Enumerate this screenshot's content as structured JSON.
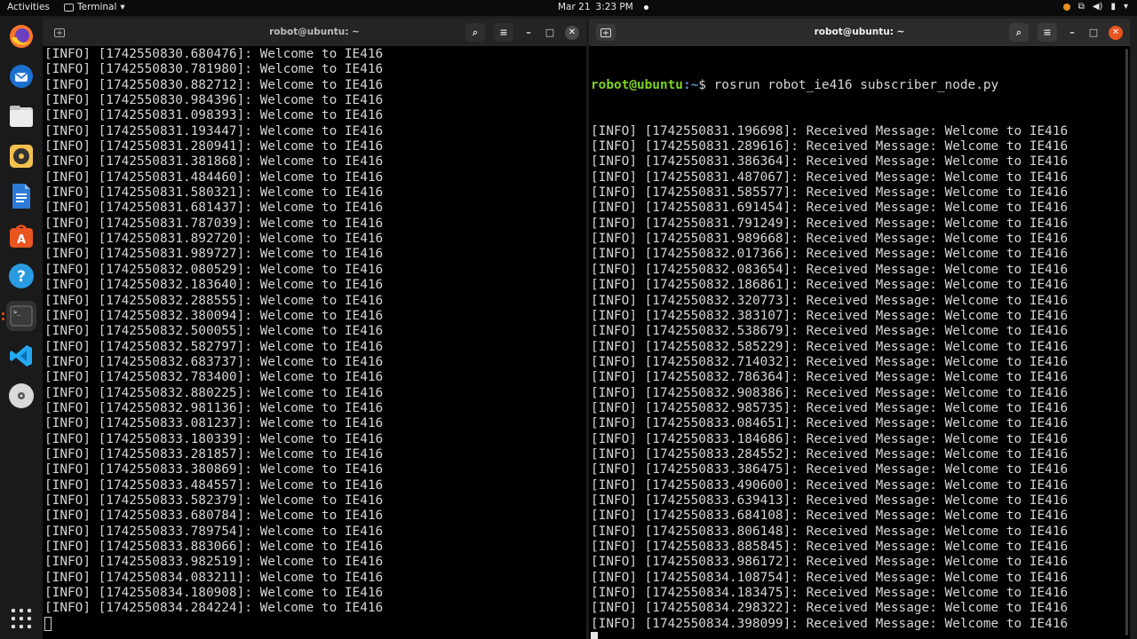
{
  "topbar": {
    "activities": "Activities",
    "app_name": "Terminal",
    "date": "Mar 21",
    "time": "3:23 PM"
  },
  "dock": {
    "items": [
      "firefox-icon",
      "thunderbird-icon",
      "files-icon",
      "rhythmbox-icon",
      "writer-icon",
      "app-center-icon",
      "help-icon",
      "terminal-icon",
      "vscode-icon",
      "disc-icon"
    ]
  },
  "left_window": {
    "title": "robot@ubuntu: ~",
    "lines": [
      "[INFO] [1742550830.680476]: Welcome to IE416",
      "[INFO] [1742550830.781980]: Welcome to IE416",
      "[INFO] [1742550830.882712]: Welcome to IE416",
      "[INFO] [1742550830.984396]: Welcome to IE416",
      "[INFO] [1742550831.098393]: Welcome to IE416",
      "[INFO] [1742550831.193447]: Welcome to IE416",
      "[INFO] [1742550831.280941]: Welcome to IE416",
      "[INFO] [1742550831.381868]: Welcome to IE416",
      "[INFO] [1742550831.484460]: Welcome to IE416",
      "[INFO] [1742550831.580321]: Welcome to IE416",
      "[INFO] [1742550831.681437]: Welcome to IE416",
      "[INFO] [1742550831.787039]: Welcome to IE416",
      "[INFO] [1742550831.892720]: Welcome to IE416",
      "[INFO] [1742550831.989727]: Welcome to IE416",
      "[INFO] [1742550832.080529]: Welcome to IE416",
      "[INFO] [1742550832.183640]: Welcome to IE416",
      "[INFO] [1742550832.288555]: Welcome to IE416",
      "[INFO] [1742550832.380094]: Welcome to IE416",
      "[INFO] [1742550832.500055]: Welcome to IE416",
      "[INFO] [1742550832.582797]: Welcome to IE416",
      "[INFO] [1742550832.683737]: Welcome to IE416",
      "[INFO] [1742550832.783400]: Welcome to IE416",
      "[INFO] [1742550832.880225]: Welcome to IE416",
      "[INFO] [1742550832.981136]: Welcome to IE416",
      "[INFO] [1742550833.081237]: Welcome to IE416",
      "[INFO] [1742550833.180339]: Welcome to IE416",
      "[INFO] [1742550833.281857]: Welcome to IE416",
      "[INFO] [1742550833.380869]: Welcome to IE416",
      "[INFO] [1742550833.484557]: Welcome to IE416",
      "[INFO] [1742550833.582379]: Welcome to IE416",
      "[INFO] [1742550833.680784]: Welcome to IE416",
      "[INFO] [1742550833.789754]: Welcome to IE416",
      "[INFO] [1742550833.883066]: Welcome to IE416",
      "[INFO] [1742550833.982519]: Welcome to IE416",
      "[INFO] [1742550834.083211]: Welcome to IE416",
      "[INFO] [1742550834.180908]: Welcome to IE416",
      "[INFO] [1742550834.284224]: Welcome to IE416"
    ]
  },
  "right_window": {
    "title": "robot@ubuntu: ~",
    "prompt_user": "robot@ubuntu",
    "prompt_path": ":~",
    "prompt_symbol": "$ ",
    "command": "rosrun robot_ie416 subscriber_node.py",
    "lines": [
      "[INFO] [1742550831.196698]: Received Message: Welcome to IE416",
      "[INFO] [1742550831.289616]: Received Message: Welcome to IE416",
      "[INFO] [1742550831.386364]: Received Message: Welcome to IE416",
      "[INFO] [1742550831.487067]: Received Message: Welcome to IE416",
      "[INFO] [1742550831.585577]: Received Message: Welcome to IE416",
      "[INFO] [1742550831.691454]: Received Message: Welcome to IE416",
      "[INFO] [1742550831.791249]: Received Message: Welcome to IE416",
      "[INFO] [1742550831.989668]: Received Message: Welcome to IE416",
      "[INFO] [1742550832.017366]: Received Message: Welcome to IE416",
      "[INFO] [1742550832.083654]: Received Message: Welcome to IE416",
      "[INFO] [1742550832.186861]: Received Message: Welcome to IE416",
      "[INFO] [1742550832.320773]: Received Message: Welcome to IE416",
      "[INFO] [1742550832.383107]: Received Message: Welcome to IE416",
      "[INFO] [1742550832.538679]: Received Message: Welcome to IE416",
      "[INFO] [1742550832.585229]: Received Message: Welcome to IE416",
      "[INFO] [1742550832.714032]: Received Message: Welcome to IE416",
      "[INFO] [1742550832.786364]: Received Message: Welcome to IE416",
      "[INFO] [1742550832.908386]: Received Message: Welcome to IE416",
      "[INFO] [1742550832.985735]: Received Message: Welcome to IE416",
      "[INFO] [1742550833.084651]: Received Message: Welcome to IE416",
      "[INFO] [1742550833.184686]: Received Message: Welcome to IE416",
      "[INFO] [1742550833.284552]: Received Message: Welcome to IE416",
      "[INFO] [1742550833.386475]: Received Message: Welcome to IE416",
      "[INFO] [1742550833.490600]: Received Message: Welcome to IE416",
      "[INFO] [1742550833.639413]: Received Message: Welcome to IE416",
      "[INFO] [1742550833.684108]: Received Message: Welcome to IE416",
      "[INFO] [1742550833.806148]: Received Message: Welcome to IE416",
      "[INFO] [1742550833.885845]: Received Message: Welcome to IE416",
      "[INFO] [1742550833.986172]: Received Message: Welcome to IE416",
      "[INFO] [1742550834.108754]: Received Message: Welcome to IE416",
      "[INFO] [1742550834.183475]: Received Message: Welcome to IE416",
      "[INFO] [1742550834.298322]: Received Message: Welcome to IE416",
      "[INFO] [1742550834.398099]: Received Message: Welcome to IE416"
    ]
  },
  "colors": {
    "accent": "#e95420",
    "prompt_user": "#7ed321",
    "prompt_path": "#5a8fd8",
    "terminal_bg": "#000000",
    "terminal_fg": "#d6d6d6"
  }
}
